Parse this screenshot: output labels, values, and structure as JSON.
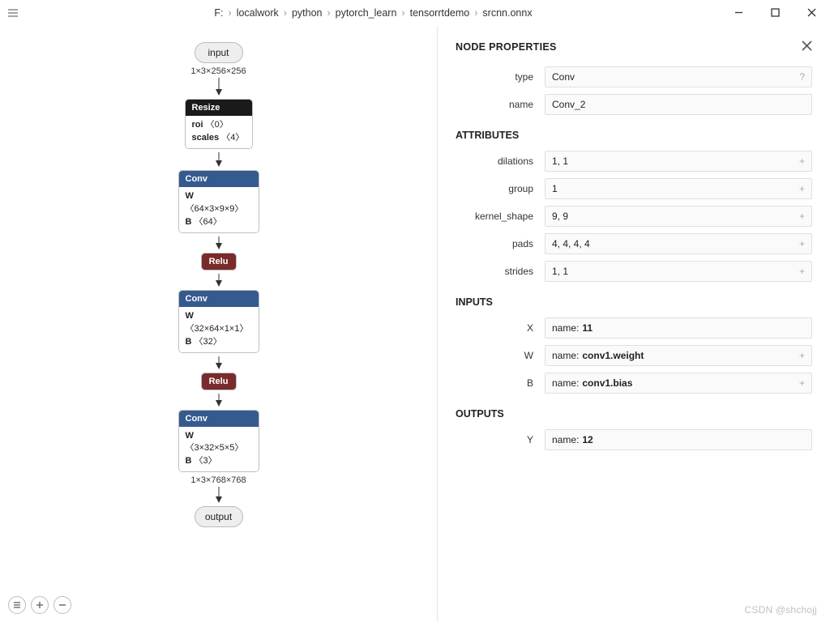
{
  "breadcrumb": {
    "root": "F:",
    "parts": [
      "localwork",
      "python",
      "pytorch_learn",
      "tensorrtdemo",
      "srcnn.onnx"
    ]
  },
  "graph": {
    "input_label": "input",
    "edge_in": "1×3×256×256",
    "resize": {
      "title": "Resize",
      "line1_k": "roi",
      "line1_v": "〈0〉",
      "line2_k": "scales",
      "line2_v": "〈4〉"
    },
    "conv1": {
      "title": "Conv",
      "w": "W",
      "w_v": "〈64×3×9×9〉",
      "b": "B",
      "b_v": "〈64〉"
    },
    "relu1": {
      "title": "Relu"
    },
    "conv2": {
      "title": "Conv",
      "w": "W",
      "w_v": "〈32×64×1×1〉",
      "b": "B",
      "b_v": "〈32〉"
    },
    "relu2": {
      "title": "Relu"
    },
    "conv3": {
      "title": "Conv",
      "w": "W",
      "w_v": "〈3×32×5×5〉",
      "b": "B",
      "b_v": "〈3〉"
    },
    "edge_out": "1×3×768×768",
    "output_label": "output"
  },
  "panel": {
    "title": "NODE PROPERTIES",
    "type_label": "type",
    "type_value": "Conv",
    "name_label": "name",
    "name_value": "Conv_2",
    "attr_section": "ATTRIBUTES",
    "attrs": {
      "dilations_label": "dilations",
      "dilations_value": "1, 1",
      "group_label": "group",
      "group_value": "1",
      "kernel_label": "kernel_shape",
      "kernel_value": "9, 9",
      "pads_label": "pads",
      "pads_value": "4, 4, 4, 4",
      "strides_label": "strides",
      "strides_value": "1, 1"
    },
    "inputs_section": "INPUTS",
    "inputs": {
      "x_label": "X",
      "x_prefix": "name: ",
      "x_bold": "11",
      "w_label": "W",
      "w_prefix": "name: ",
      "w_bold": "conv1.weight",
      "b_label": "B",
      "b_prefix": "name: ",
      "b_bold": "conv1.bias"
    },
    "outputs_section": "OUTPUTS",
    "outputs": {
      "y_label": "Y",
      "y_prefix": "name: ",
      "y_bold": "12"
    }
  },
  "watermark": "CSDN @shchojj",
  "glyphs": {
    "q": "?",
    "plus": "+"
  }
}
